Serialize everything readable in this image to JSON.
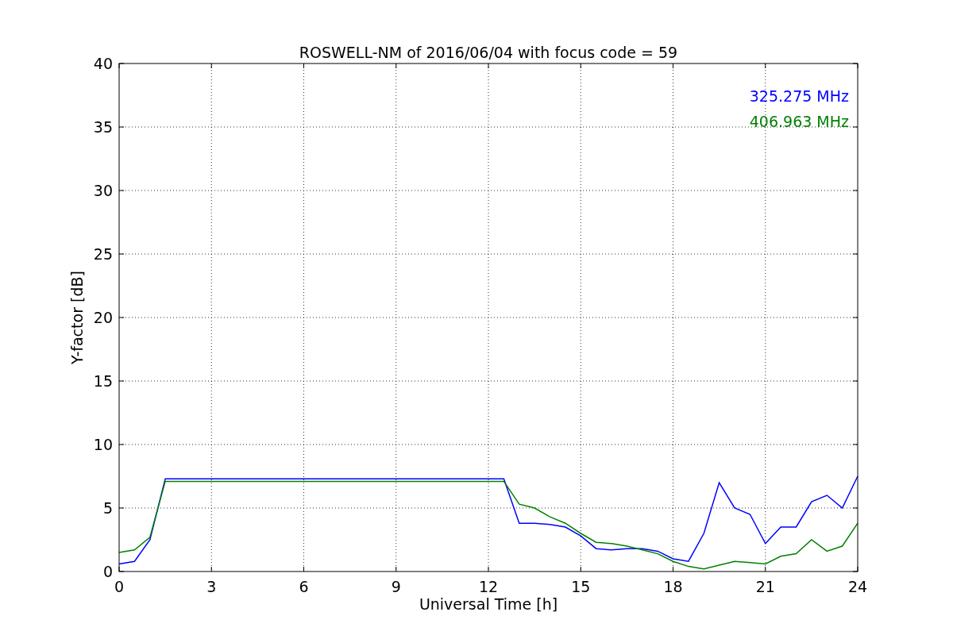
{
  "chart_data": {
    "type": "line",
    "title": "ROSWELL-NM of 2016/06/04 with focus code = 59",
    "xlabel": "Universal Time [h]",
    "ylabel": "Y-factor [dB]",
    "x": [
      0,
      0.5,
      1,
      1.5,
      2,
      2.5,
      3,
      3.5,
      4,
      4.5,
      5,
      5.5,
      6,
      6.5,
      7,
      7.5,
      8,
      8.5,
      9,
      9.5,
      10,
      10.5,
      11,
      11.5,
      12,
      12.5,
      13,
      13.5,
      14,
      14.5,
      15,
      15.5,
      16,
      16.5,
      17,
      17.5,
      18,
      18.5,
      19,
      19.5,
      20,
      20.5,
      21,
      21.5,
      22,
      22.5,
      23,
      23.5,
      24
    ],
    "series": [
      {
        "name": "325.275 MHz",
        "color": "#0000ff",
        "values": [
          0.6,
          0.8,
          2.5,
          7.3,
          7.3,
          7.3,
          7.3,
          7.3,
          7.3,
          7.3,
          7.3,
          7.3,
          7.3,
          7.3,
          7.3,
          7.3,
          7.3,
          7.3,
          7.3,
          7.3,
          7.3,
          7.3,
          7.3,
          7.3,
          7.3,
          7.3,
          3.8,
          3.8,
          3.7,
          3.5,
          2.8,
          1.8,
          1.7,
          1.8,
          1.8,
          1.6,
          1.0,
          0.8,
          3.0,
          7.0,
          5.0,
          4.5,
          2.2,
          3.5,
          3.5,
          5.5,
          6.0,
          5.0,
          7.5
        ]
      },
      {
        "name": "406.963 MHz",
        "color": "#008000",
        "values": [
          1.5,
          1.7,
          2.7,
          7.1,
          7.1,
          7.1,
          7.1,
          7.1,
          7.1,
          7.1,
          7.1,
          7.1,
          7.1,
          7.1,
          7.1,
          7.1,
          7.1,
          7.1,
          7.1,
          7.1,
          7.1,
          7.1,
          7.1,
          7.1,
          7.1,
          7.1,
          5.3,
          5.0,
          4.3,
          3.8,
          3.0,
          2.3,
          2.2,
          2.0,
          1.7,
          1.4,
          0.8,
          0.4,
          0.2,
          0.5,
          0.8,
          0.7,
          0.6,
          1.2,
          1.4,
          2.5,
          1.6,
          2.0,
          3.8
        ]
      }
    ],
    "xlim": [
      0,
      24
    ],
    "ylim": [
      0,
      40
    ],
    "xticks": [
      0,
      3,
      6,
      9,
      12,
      15,
      18,
      21,
      24
    ],
    "yticks": [
      0,
      5,
      10,
      15,
      20,
      25,
      30,
      35,
      40
    ],
    "grid": true
  }
}
